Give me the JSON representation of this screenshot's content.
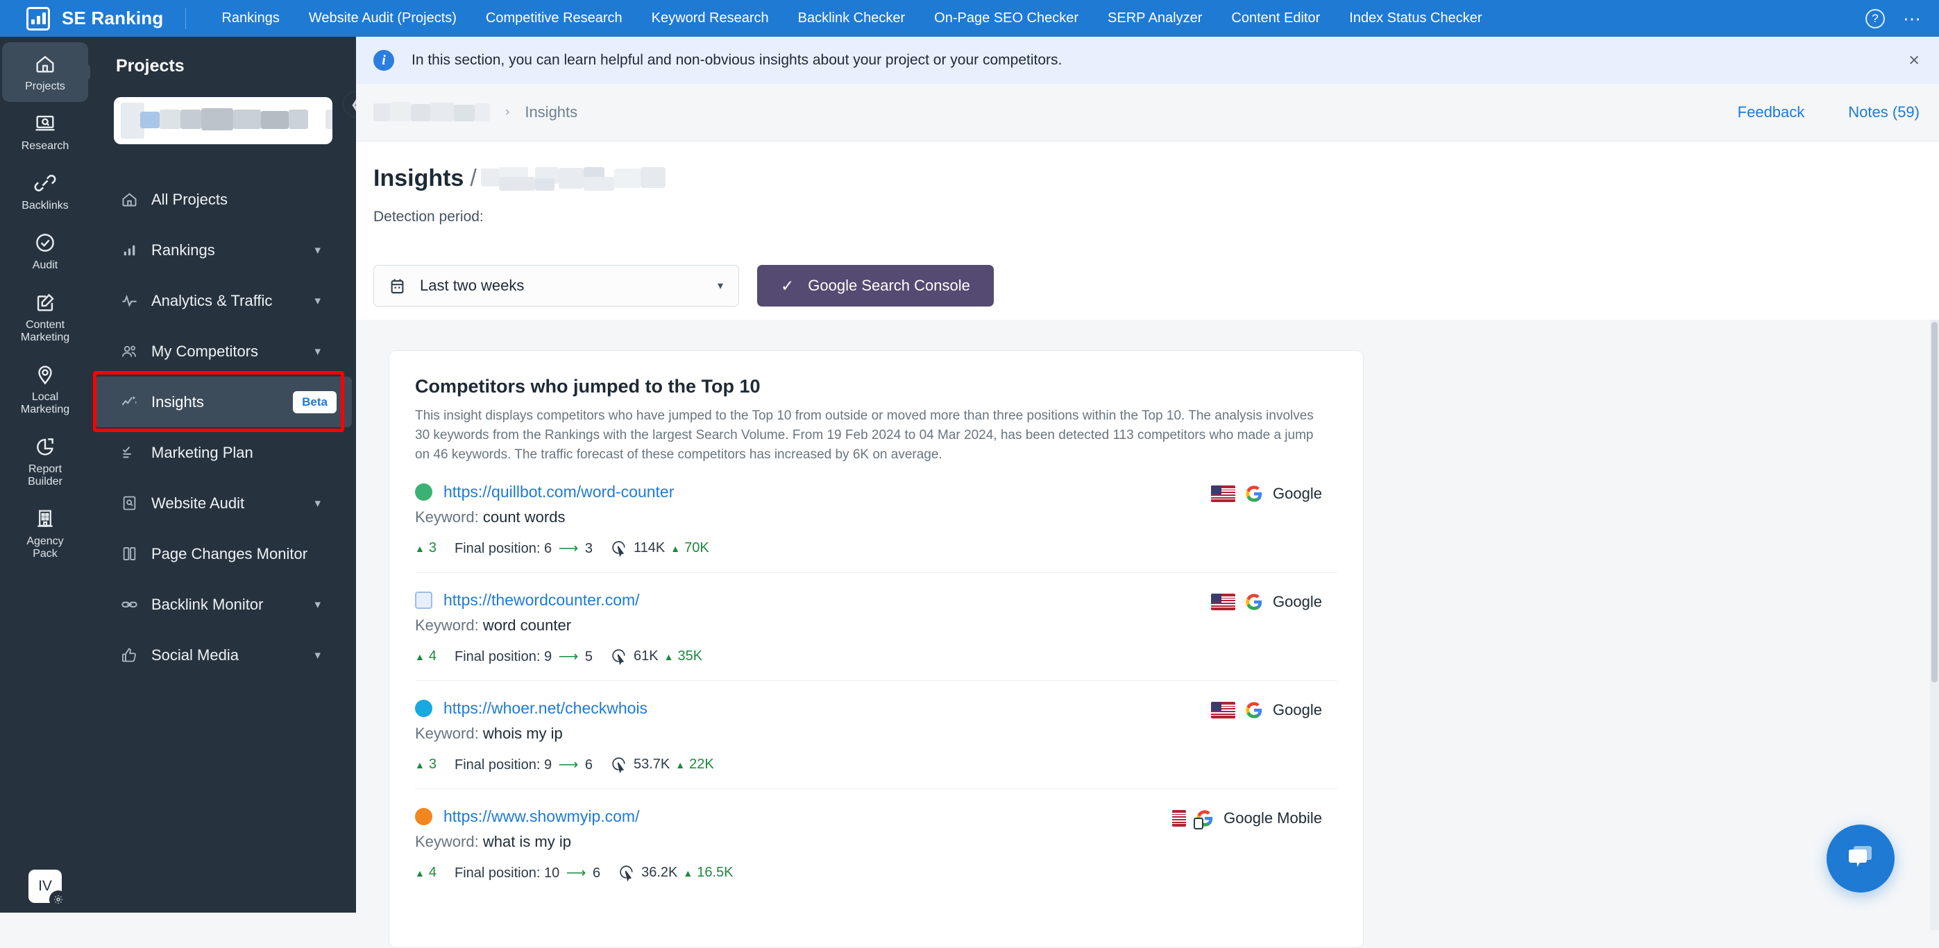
{
  "brand": {
    "name": "SE Ranking",
    "logo_icon": "bar-chart-logo-icon"
  },
  "topnav": {
    "items": [
      {
        "label": "Rankings"
      },
      {
        "label": "Website Audit (Projects)"
      },
      {
        "label": "Competitive Research"
      },
      {
        "label": "Keyword Research"
      },
      {
        "label": "Backlink Checker"
      },
      {
        "label": "On-Page SEO Checker"
      },
      {
        "label": "SERP Analyzer"
      },
      {
        "label": "Content Editor"
      },
      {
        "label": "Index Status Checker"
      }
    ],
    "help_icon": "question-mark-circle-icon",
    "more_icon": "ellipsis-icon"
  },
  "rail": {
    "items": [
      {
        "label": "Projects",
        "icon": "home-icon",
        "active": true
      },
      {
        "label": "Research",
        "icon": "laptop-search-icon",
        "active": false
      },
      {
        "label": "Backlinks",
        "icon": "link-chain-icon",
        "active": false
      },
      {
        "label": "Audit",
        "icon": "check-circle-icon",
        "active": false
      },
      {
        "label": "Content\nMarketing",
        "icon": "pencil-square-icon",
        "active": false
      },
      {
        "label": "Local\nMarketing",
        "icon": "map-pin-icon",
        "active": false
      },
      {
        "label": "Report\nBuilder",
        "icon": "pie-chart-icon",
        "active": false
      },
      {
        "label": "Agency\nPack",
        "icon": "building-icon",
        "active": false
      }
    ],
    "avatar_initials": "IV",
    "avatar_gear_icon": "gear-icon"
  },
  "panel": {
    "title": "Projects",
    "collapse_icon": "chevron-left-icon",
    "project_selector_value": "",
    "menu": [
      {
        "label": "All Projects",
        "icon": "home-icon",
        "chevron": false,
        "selected": false,
        "badge": ""
      },
      {
        "label": "Rankings",
        "icon": "bar-chart-icon",
        "chevron": true,
        "selected": false,
        "badge": ""
      },
      {
        "label": "Analytics & Traffic",
        "icon": "pulse-icon",
        "chevron": true,
        "selected": false,
        "badge": ""
      },
      {
        "label": "My Competitors",
        "icon": "people-icon",
        "chevron": true,
        "selected": false,
        "badge": ""
      },
      {
        "label": "Insights",
        "icon": "insights-sparkle-icon",
        "chevron": false,
        "selected": true,
        "badge": "Beta"
      },
      {
        "label": "Marketing Plan",
        "icon": "checklist-icon",
        "chevron": false,
        "selected": false,
        "badge": ""
      },
      {
        "label": "Website Audit",
        "icon": "magnifier-doc-icon",
        "chevron": true,
        "selected": false,
        "badge": ""
      },
      {
        "label": "Page Changes Monitor",
        "icon": "page-split-icon",
        "chevron": false,
        "selected": false,
        "badge": ""
      },
      {
        "label": "Backlink Monitor",
        "icon": "link-chain-icon",
        "chevron": true,
        "selected": false,
        "badge": ""
      },
      {
        "label": "Social Media",
        "icon": "thumbs-up-icon",
        "chevron": true,
        "selected": false,
        "badge": ""
      }
    ]
  },
  "notice": {
    "icon": "info-icon",
    "text": "In this section, you can learn helpful and non-obvious insights about your project or your competitors.",
    "close_icon": "close-icon"
  },
  "breadcrumb": {
    "project_redacted": "",
    "separator": "›",
    "current": "Insights",
    "feedback_label": "Feedback",
    "notes_label": "Notes (59)"
  },
  "page": {
    "title": "Insights",
    "title_separator": "/",
    "title_project_redacted": "",
    "detection_period_label": "Detection period:",
    "period_value": "Last two weeks",
    "period_icon": "calendar-icon",
    "period_chevron": "chevron-down-icon",
    "gsc_button_label": "Google Search Console",
    "gsc_check_icon": "check-icon"
  },
  "card": {
    "title": "Competitors who jumped to the Top 10",
    "description": "This insight displays competitors who have jumped to the Top 10 from outside or moved more than three positions within the Top 10. The analysis involves 30 keywords from the Rankings with the largest Search Volume. From 19 Feb 2024 to 04 Mar 2024, has been detected 113 competitors who made a jump on 46 keywords. The traffic forecast of these competitors has increased by 6K on average.",
    "final_position_label": "Final position:",
    "keyword_label": "Keyword:",
    "rows": [
      {
        "url": "https://quillbot.com/word-counter",
        "favicon": "quillbot-favicon",
        "favicon_color": "#3bb273",
        "keyword": "count words",
        "jump": "3",
        "position_from": "6",
        "position_to": "3",
        "traffic": "114K",
        "traffic_delta": "70K",
        "traffic_icon": "cursor-click-icon",
        "flag": "us-flag-icon",
        "engine": "Google",
        "engine_icon": "google-g-icon",
        "mobile": false
      },
      {
        "url": "https://thewordcounter.com/",
        "favicon": "thewordcounter-favicon",
        "favicon_color": "#cfe0f5",
        "keyword": "word counter",
        "jump": "4",
        "position_from": "9",
        "position_to": "5",
        "traffic": "61K",
        "traffic_delta": "35K",
        "traffic_icon": "cursor-click-icon",
        "flag": "us-flag-icon",
        "engine": "Google",
        "engine_icon": "google-g-icon",
        "mobile": false
      },
      {
        "url": "https://whoer.net/checkwhois",
        "favicon": "whoer-favicon",
        "favicon_color": "#17a9e0",
        "keyword": "whois my ip",
        "jump": "3",
        "position_from": "9",
        "position_to": "6",
        "traffic": "53.7K",
        "traffic_delta": "22K",
        "traffic_icon": "cursor-click-icon",
        "flag": "us-flag-icon",
        "engine": "Google",
        "engine_icon": "google-g-icon",
        "mobile": false
      },
      {
        "url": "https://www.showmyip.com/",
        "favicon": "showmyip-favicon",
        "favicon_color": "#f2861e",
        "keyword": "what is my ip",
        "jump": "4",
        "position_from": "10",
        "position_to": "6",
        "traffic": "36.2K",
        "traffic_delta": "16.5K",
        "traffic_icon": "cursor-click-icon",
        "flag": "us-flag-icon",
        "engine": "Google Mobile",
        "engine_icon": "google-g-mobile-icon",
        "mobile": true
      }
    ]
  },
  "chat": {
    "icon": "chat-bubbles-icon"
  },
  "colors": {
    "brand_blue": "#1f7ad4",
    "sidebar_dark": "#26333f",
    "sidebar_active": "#3c4c5b",
    "highlight_red": "#fe0000",
    "gsc_purple": "#554a71",
    "growth_green": "#1a8a3d",
    "link_blue": "#1f7ad4"
  }
}
